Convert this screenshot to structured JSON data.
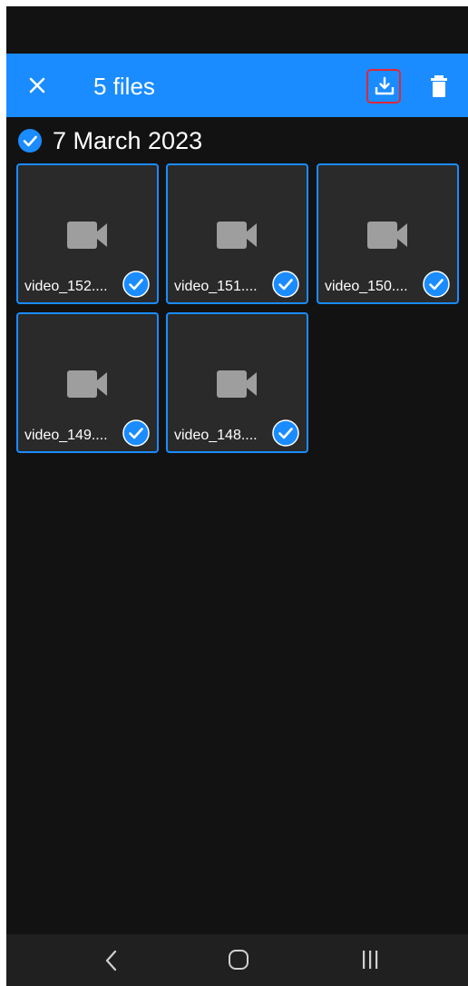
{
  "appbar": {
    "title": "5 files",
    "accent_color": "#1a8cff",
    "close_icon": "close-icon",
    "download_icon": "download-icon",
    "delete_icon": "trash-icon"
  },
  "section": {
    "date": "7 March 2023",
    "selected": true
  },
  "files": [
    {
      "name": "video_152....",
      "selected": true,
      "icon": "video-camera-icon"
    },
    {
      "name": "video_151....",
      "selected": true,
      "icon": "video-camera-icon"
    },
    {
      "name": "video_150....",
      "selected": true,
      "icon": "video-camera-icon"
    },
    {
      "name": "video_149....",
      "selected": true,
      "icon": "video-camera-icon"
    },
    {
      "name": "video_148....",
      "selected": true,
      "icon": "video-camera-icon"
    }
  ],
  "navbar": {
    "back_icon": "back-chevron-icon",
    "home_icon": "home-icon",
    "recents_icon": "recent-apps-icon"
  }
}
